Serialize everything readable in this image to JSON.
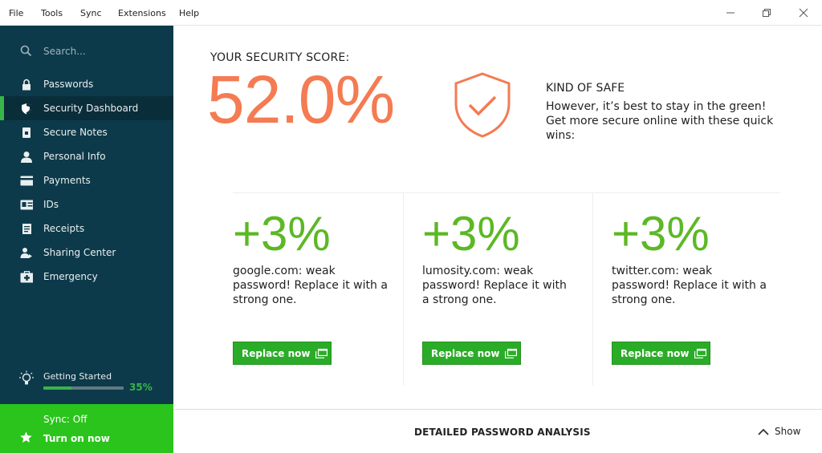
{
  "menu": {
    "items": [
      "File",
      "Tools",
      "Sync",
      "Extensions",
      "Help"
    ]
  },
  "sidebar": {
    "search_placeholder": "Search...",
    "items": [
      {
        "label": "Passwords",
        "icon": "lock-icon"
      },
      {
        "label": "Security Dashboard",
        "icon": "shield-icon",
        "active": true
      },
      {
        "label": "Secure Notes",
        "icon": "note-icon"
      },
      {
        "label": "Personal Info",
        "icon": "person-icon"
      },
      {
        "label": "Payments",
        "icon": "card-icon"
      },
      {
        "label": "IDs",
        "icon": "id-card-icon"
      },
      {
        "label": "Receipts",
        "icon": "receipt-icon"
      },
      {
        "label": "Sharing Center",
        "icon": "sharing-icon"
      },
      {
        "label": "Emergency",
        "icon": "first-aid-icon"
      }
    ],
    "getting_started": {
      "label": "Getting Started",
      "progress": 35,
      "progress_text": "35%"
    },
    "sync": {
      "status": "Sync: Off",
      "action": "Turn on now"
    }
  },
  "score": {
    "heading": "YOUR SECURITY SCORE:",
    "value": "52.0%",
    "level_title": "KIND OF SAFE",
    "level_desc": "However, it’s best to stay in the green! Get more secure online with these quick wins:"
  },
  "cards": [
    {
      "pct": "+3%",
      "desc": "google.com: weak password! Replace it with a strong one.",
      "button": "Replace now"
    },
    {
      "pct": "+3%",
      "desc": "lumosity.com: weak password! Replace it with a strong one.",
      "button": "Replace now"
    },
    {
      "pct": "+3%",
      "desc": "twitter.com: weak password! Replace it with a strong one.",
      "button": "Replace now"
    }
  ],
  "bottom": {
    "analysis_label": "DETAILED PASSWORD ANALYSIS",
    "show_label": "Show"
  },
  "colors": {
    "sidebar_bg": "#0d3a4a",
    "score_orange": "#f47b52",
    "green_accent": "#39b54a",
    "button_green": "#2bac28",
    "sync_green": "#2bc41c"
  }
}
